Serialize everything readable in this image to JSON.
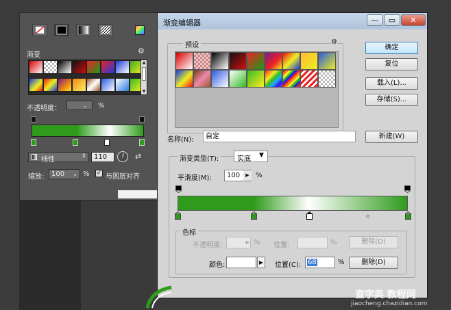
{
  "left_panel": {
    "section_label": "渐变",
    "opacity_label": "不透明度：",
    "opacity_unit": "%",
    "style_label": "线性",
    "angle_value": "110",
    "scale_label": "缩放:",
    "scale_value": "100",
    "scale_unit": "%",
    "align_label": "与图层对齐",
    "align_checked": true,
    "gradient_colors": [
      "#2e9b1c",
      "#ffffff",
      "#2e9b1c"
    ]
  },
  "dialog": {
    "title": "渐变编辑器",
    "presets_label": "预设",
    "buttons": {
      "ok": "确定",
      "reset": "复位",
      "load": "载入(L)...",
      "save": "存储(S)...",
      "new": "新建(W)"
    },
    "name_label": "名称(N):",
    "name_value": "自定",
    "type_label": "渐变类型(T):",
    "type_value": "实底",
    "smooth_label": "平滑度(M):",
    "smooth_value": "100",
    "smooth_unit": "%",
    "stops_label": "色标",
    "stop_opacity_label": "不透明度:",
    "stop_opacity_unit": "%",
    "stop_position_label_top": "位置:",
    "stop_position_unit_top": "%",
    "delete_top": "删除(D)",
    "color_label": "颜色:",
    "color_position_label": "位置(C):",
    "color_position_value": "68",
    "color_position_unit": "%",
    "delete_bottom": "删除(D)",
    "gradient_colors": [
      "#2e9b1c",
      "#ffffff",
      "#2e9b1c"
    ],
    "color_stops": [
      0,
      33,
      57,
      100
    ],
    "selected_stop": 57
  },
  "watermark": {
    "line1": "查字典 教程网",
    "line2": "jiaocheng.chazidian.com"
  }
}
